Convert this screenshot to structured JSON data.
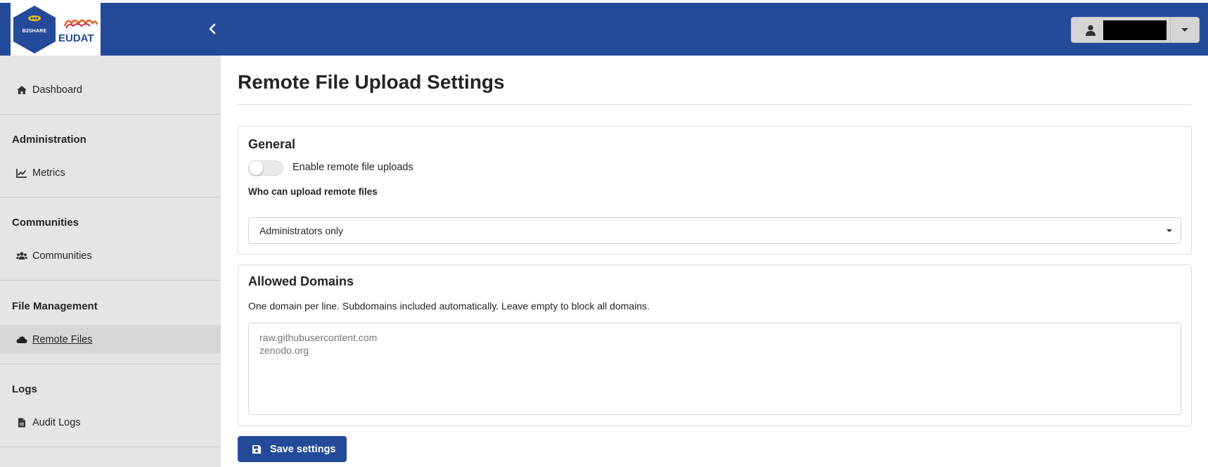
{
  "header": {
    "logo_hex_text": "B2SHARE",
    "logo_brand_text": "EUDAT",
    "user_name": "",
    "accent_color": "#244b9a"
  },
  "sidebar": {
    "dashboard_label": "Dashboard",
    "sections": [
      {
        "heading": "Administration",
        "items": [
          {
            "label": "Metrics",
            "icon": "chart-line-icon"
          }
        ]
      },
      {
        "heading": "Communities",
        "items": [
          {
            "label": "Communities",
            "icon": "users-icon"
          }
        ]
      },
      {
        "heading": "File Management",
        "items": [
          {
            "label": "Remote Files",
            "icon": "cloud-icon",
            "active": true
          }
        ]
      },
      {
        "heading": "Logs",
        "items": [
          {
            "label": "Audit Logs",
            "icon": "file-icon"
          }
        ]
      }
    ]
  },
  "main": {
    "title": "Remote File Upload Settings",
    "general": {
      "title": "General",
      "toggle_label": "Enable remote file uploads",
      "toggle_on": false,
      "who_label": "Who can upload remote files",
      "who_value": "Administrators only"
    },
    "domains": {
      "title": "Allowed Domains",
      "help": "One domain per line. Subdomains included automatically. Leave empty to block all domains.",
      "placeholder": "raw.githubusercontent.com\nzenodo.org"
    },
    "save_label": "Save settings"
  }
}
